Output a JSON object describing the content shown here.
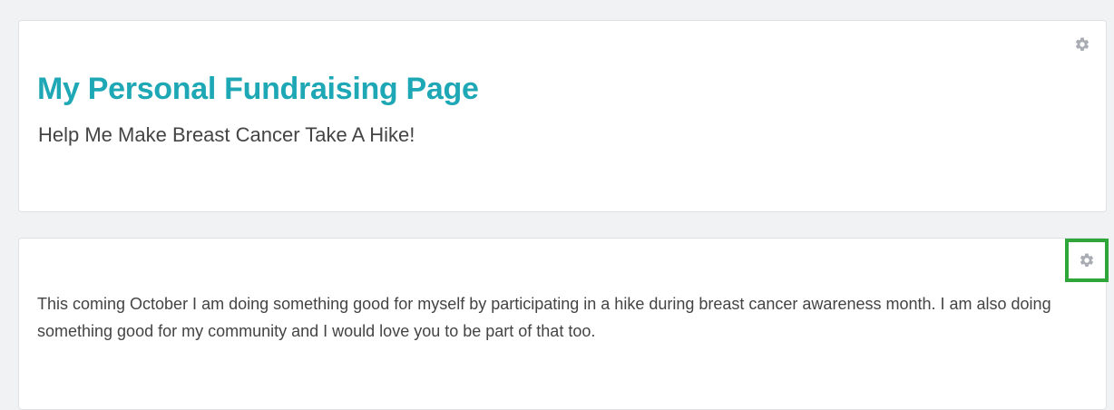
{
  "header_panel": {
    "title": "My Personal Fundraising Page",
    "subtitle": "Help Me Make Breast Cancer Take A Hike!",
    "settings_icon": "gear-icon"
  },
  "story_panel": {
    "text": "This coming October I am doing something good for myself by participating in a hike during breast cancer awareness month. I am also doing something good for my community and I would love you to be part of that too.",
    "settings_icon": "gear-icon",
    "highlight_color": "#2ea63a"
  },
  "colors": {
    "title": "#1ea7b5",
    "body_text": "#444444",
    "icon": "#a9adb3",
    "background": "#f1f2f4"
  }
}
